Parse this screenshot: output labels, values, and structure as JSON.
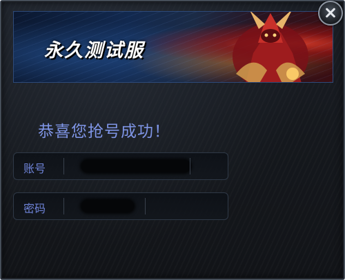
{
  "banner": {
    "title": "永久测试服"
  },
  "dialog": {
    "message": "恭喜您抢号成功！",
    "account": {
      "label": "账号",
      "value": ""
    },
    "password": {
      "label": "密码",
      "value": ""
    }
  },
  "icons": {
    "close": "close-icon"
  },
  "colors": {
    "accent_text": "#7f95e6",
    "label_text": "#6f84d9",
    "background": "#15181d"
  }
}
